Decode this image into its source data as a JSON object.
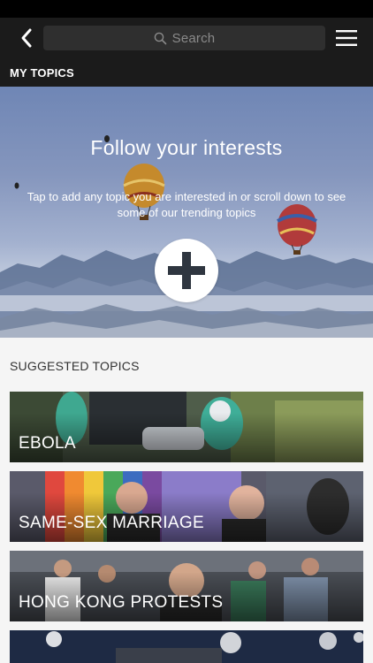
{
  "search": {
    "placeholder": "Search"
  },
  "section": {
    "my_topics": "MY TOPICS"
  },
  "hero": {
    "title": "Follow your interests",
    "subtitle": "Tap to add any topic you are interested in or scroll down to see some of our trending topics"
  },
  "suggested": {
    "title": "SUGGESTED TOPICS",
    "topics": [
      {
        "label": "EBOLA"
      },
      {
        "label": "SAME-SEX MARRIAGE"
      },
      {
        "label": "HONG KONG PROTESTS"
      },
      {
        "label": ""
      }
    ]
  },
  "colors": {
    "bar": "#1b1b1b",
    "statusbar": "#000000",
    "background": "#f5f5f5"
  }
}
